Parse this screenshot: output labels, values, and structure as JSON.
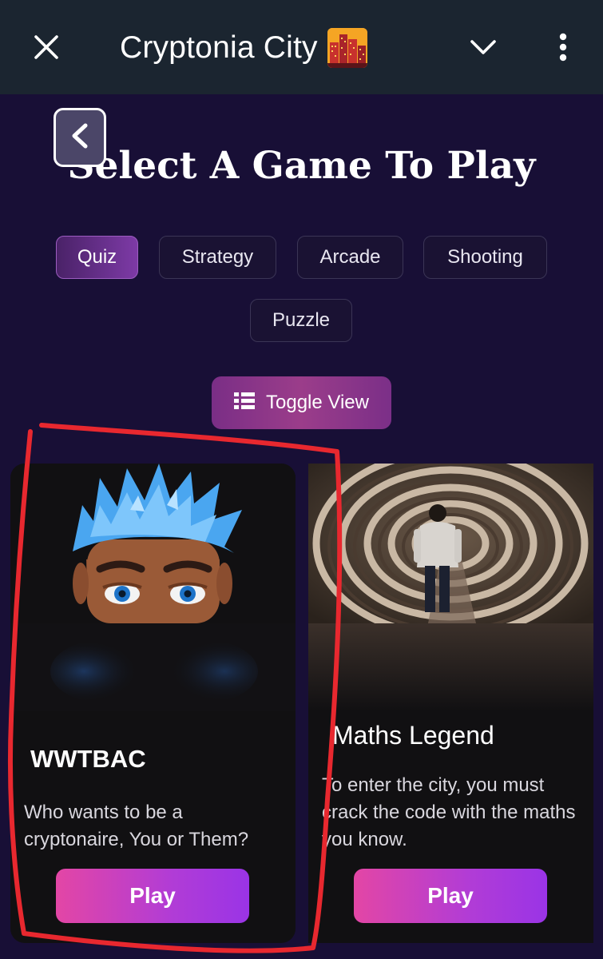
{
  "app_bar": {
    "title": "Cryptonia City",
    "title_emoji": "city-emoji",
    "close_icon": "close-icon",
    "collapse_icon": "chevron-down-icon",
    "menu_icon": "more-vertical-icon"
  },
  "header": {
    "back_icon": "chevron-left-icon",
    "title": "Select A Game To Play"
  },
  "categories": {
    "active": "Quiz",
    "items": [
      "Quiz",
      "Strategy",
      "Arcade",
      "Shooting",
      "Puzzle"
    ]
  },
  "toggle_view": {
    "label": "Toggle View",
    "icon": "list-view-icon"
  },
  "games": [
    {
      "title": "WWTBAC",
      "description": "Who wants to be a cryptonaire, You or Them?",
      "play_label": "Play",
      "image": "blue-haired-avatar"
    },
    {
      "title": "Maths Legend",
      "description": "To enter the city, you must crack the code with the maths you know.",
      "play_label": "Play",
      "image": "person-in-maze"
    }
  ],
  "colors": {
    "background": "#180f36",
    "app_bar": "#1b2530",
    "accent_pink": "#e346a5",
    "accent_purple": "#9a34e6",
    "annotation_red": "#e8282f"
  }
}
